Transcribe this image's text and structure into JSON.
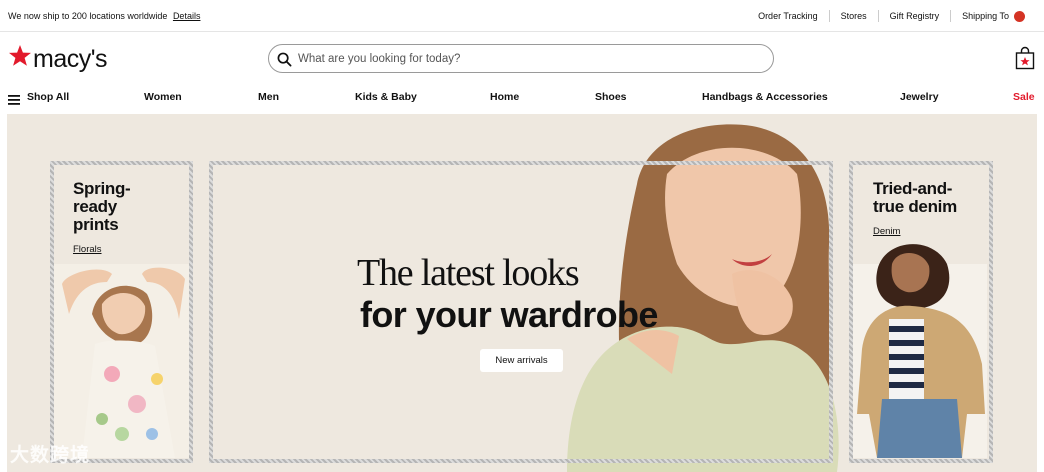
{
  "utility": {
    "promo_text": "We now ship to 200 locations worldwide",
    "promo_link": "Details",
    "links": [
      "Order Tracking",
      "Stores",
      "Gift Registry",
      "Shipping To"
    ]
  },
  "header": {
    "logo_text": "macy's",
    "search_placeholder": "What are you looking for today?"
  },
  "nav": {
    "shop_all": "Shop All",
    "items": [
      "Women",
      "Men",
      "Kids & Baby",
      "Home",
      "Shoes",
      "Handbags & Accessories",
      "Jewelry",
      "Sale"
    ]
  },
  "hero": {
    "headline_1": "The latest looks",
    "headline_2": "for your wardrobe",
    "cta": "New arrivals",
    "left_title": "Spring-\nready\nprints",
    "left_link": "Florals",
    "right_title": "Tried-and-\ntrue denim",
    "right_link": "Denim"
  },
  "watermark": "大数跨境",
  "colors": {
    "brand_red": "#e21a2c",
    "hero_bg": "#eee8df",
    "sale": "#e21a2c"
  },
  "icons": [
    "star-icon",
    "search-icon",
    "shopping-bag-icon",
    "menu-icon",
    "flag-icon"
  ]
}
